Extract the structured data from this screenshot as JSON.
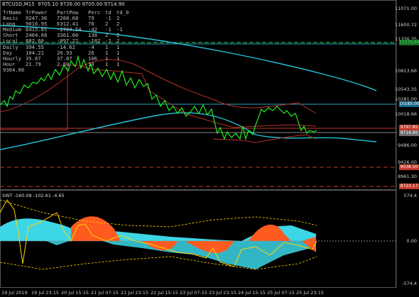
{
  "chart": {
    "title": "BTCUSD,M15  9705.10 9726.00 9705.00 9714.90",
    "sub_title": "SWT -160.08 -102.61 -4.65"
  },
  "stats_table": {
    "headers": [
      "TrName",
      "TrPower",
      "PartPow",
      "Perc",
      "td",
      "td_0"
    ],
    "rows": [
      [
        "Basic",
        "9247.36",
        "7288.68",
        "79",
        "-1",
        "2"
      ],
      [
        "Long",
        "9016.95",
        "6312.41",
        "70",
        "2",
        "2"
      ],
      [
        "Medium",
        "6415.85",
        "-2704.54",
        "-42",
        "-1",
        "-1"
      ],
      [
        "Short",
        "2404.68",
        "3301.00",
        "138",
        "2",
        "2"
      ],
      [
        "Local",
        "882.60",
        "-897.22",
        "-102",
        "-2",
        "2"
      ],
      [
        "Daily",
        "394.55",
        "-14.62",
        "-4",
        "1",
        "1"
      ],
      [
        "Day",
        "104.21",
        "26.93",
        "26",
        "1",
        "1"
      ],
      [
        "Hourly",
        "35.67",
        "37.87",
        "106",
        "1",
        "1"
      ],
      [
        "Hour",
        "21.79",
        "2.80",
        "13",
        "1",
        "1"
      ],
      [
        "9364.06",
        "",
        "",
        "",
        "",
        ""
      ]
    ]
  },
  "y_axis": {
    "labels": [
      "11071.00",
      "11600.72",
      "11330.35",
      "10813.66",
      "10543.35",
      "10281.00",
      "10018.66",
      "9486.00",
      "9426.00",
      "8961.30"
    ],
    "tags": [
      {
        "text": "11275.84",
        "color": "#39d353",
        "bg": "#1f6f2a"
      },
      {
        "text": "10185.00",
        "color": "#ffffff",
        "bg": "#1e6a8a"
      },
      {
        "text": "9797.85",
        "color": "#ffffff",
        "bg": "#c0392b"
      },
      {
        "text": "9714.90",
        "color": "#ffffff",
        "bg": "#6e6e6e"
      },
      {
        "text": "9038.50",
        "color": "#ffffff",
        "bg": "#c0392b"
      },
      {
        "text": "8723.17",
        "color": "#ffffff",
        "bg": "#c0392b"
      }
    ]
  },
  "sub_y_axis": {
    "labels": [
      "574.4",
      "0.00",
      "-574.4"
    ]
  },
  "x_axis": {
    "labels": [
      "19 Jul 2019",
      "19 Jul 23:15",
      "20 Jul 15:15",
      "21 Jul 07:15",
      "21 Jul 23:15",
      "22 Jul 15:15",
      "23 Jul 07:15",
      "23 Jul 23:15",
      "24 Jul 15:15",
      "25 Jul 07:15",
      "25 Jul 23:15"
    ]
  },
  "colors": {
    "price": "#22ff22",
    "ma_cyan": "#22c4d8",
    "ma_red": "#c0392b",
    "histo_cyan": "#3cd6e6",
    "histo_orange": "#ff5a1f",
    "histo_yellow": "#ffd400"
  }
}
